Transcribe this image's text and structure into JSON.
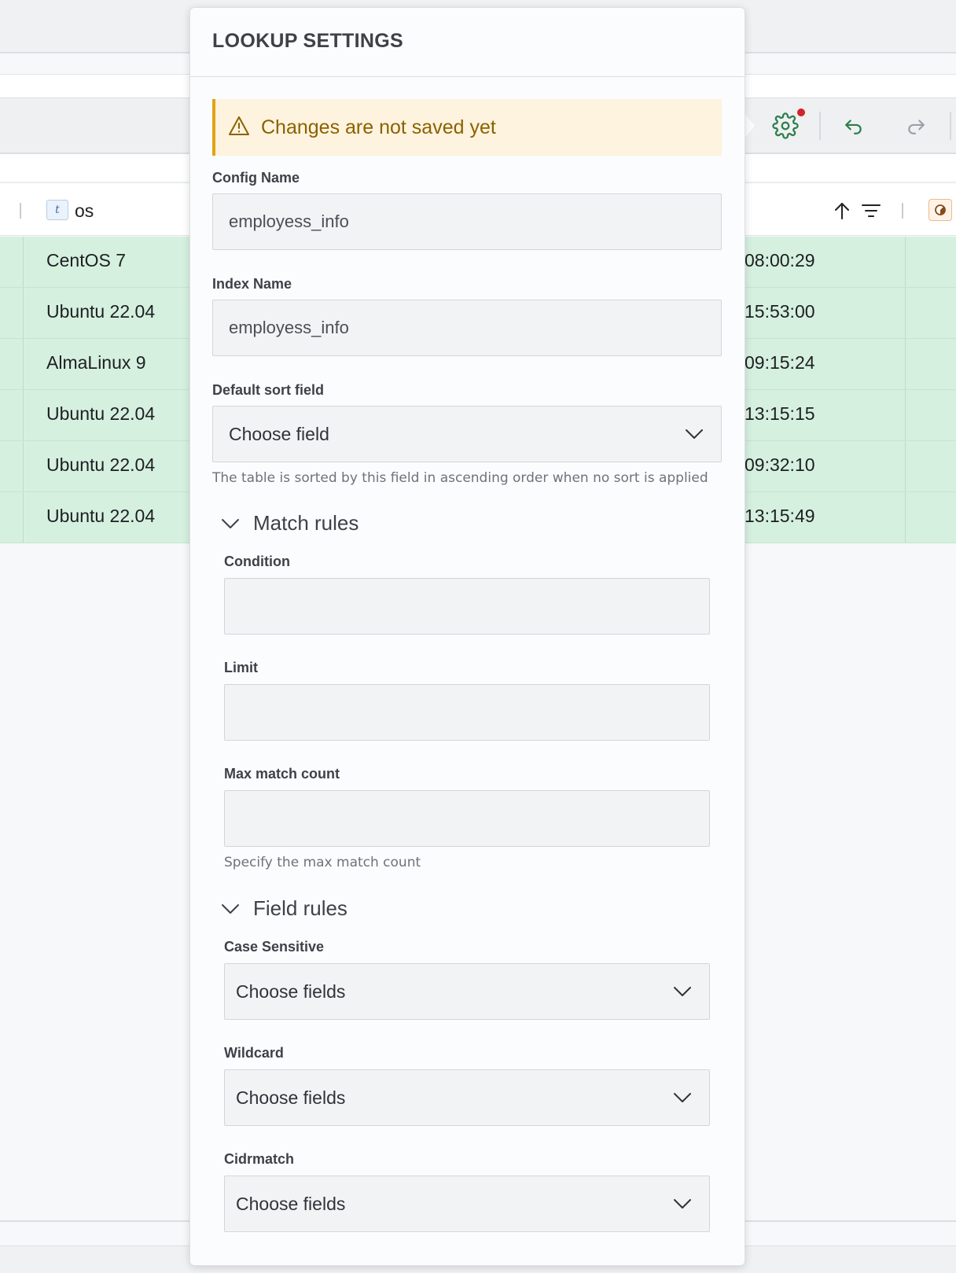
{
  "table": {
    "column_type_badge": "t",
    "column_title": "os",
    "rows": [
      {
        "os": "CentOS 7",
        "time": "08:00:29"
      },
      {
        "os": "Ubuntu 22.04",
        "time": "15:53:00"
      },
      {
        "os": "AlmaLinux 9",
        "time": "09:15:24"
      },
      {
        "os": "Ubuntu 22.04",
        "time": "13:15:15"
      },
      {
        "os": "Ubuntu 22.04",
        "time": "09:32:10"
      },
      {
        "os": "Ubuntu 22.04",
        "time": "13:15:49"
      }
    ]
  },
  "toolbar": {
    "icons": [
      "gear-icon",
      "undo-icon",
      "redo-icon"
    ],
    "settings_has_notification": true
  },
  "panel": {
    "title": "LOOKUP SETTINGS",
    "alert": "Changes are not saved yet",
    "config_name": {
      "label": "Config Name",
      "value": "employess_info"
    },
    "index_name": {
      "label": "Index Name",
      "value": "employess_info"
    },
    "default_sort": {
      "label": "Default sort field",
      "value": "Choose field",
      "help": "The table is sorted by this field in ascending order when no sort is applied"
    },
    "match_rules": {
      "title": "Match rules",
      "condition": {
        "label": "Condition",
        "value": ""
      },
      "limit": {
        "label": "Limit",
        "value": ""
      },
      "max_match_count": {
        "label": "Max match count",
        "value": "",
        "help": "Specify the max match count"
      }
    },
    "field_rules": {
      "title": "Field rules",
      "case_sensitive": {
        "label": "Case Sensitive",
        "value": "Choose fields"
      },
      "wildcard": {
        "label": "Wildcard",
        "value": "Choose fields"
      },
      "cidrmatch": {
        "label": "Cidrmatch",
        "value": "Choose fields"
      }
    }
  },
  "colors": {
    "row_bg": "#d6f0e0",
    "alert_bg": "#fdf3de",
    "alert_border": "#e3a217",
    "alert_text": "#8a6200",
    "notification_dot": "#d0232b",
    "accent_green": "#2e7d4a"
  }
}
